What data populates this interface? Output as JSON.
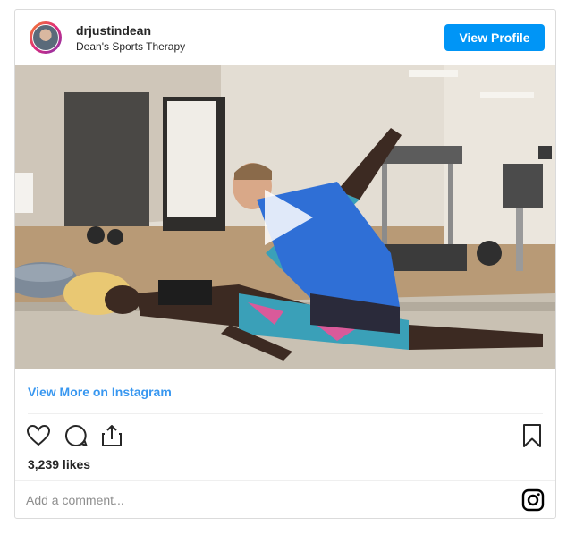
{
  "post": {
    "username": "drjustindean",
    "subtitle": "Dean's Sports Therapy",
    "view_profile_label": "View Profile",
    "view_more_label": "View More on Instagram",
    "likes": "3,239 likes",
    "comment_placeholder": "Add a comment..."
  },
  "icons": [
    "heart-icon",
    "comment-icon",
    "share-icon",
    "bookmark-icon",
    "instagram-icon",
    "play-icon"
  ],
  "colors": {
    "accent": "#0095f6",
    "link": "#3897f0",
    "text": "#262626",
    "muted": "#8e8e8e"
  }
}
